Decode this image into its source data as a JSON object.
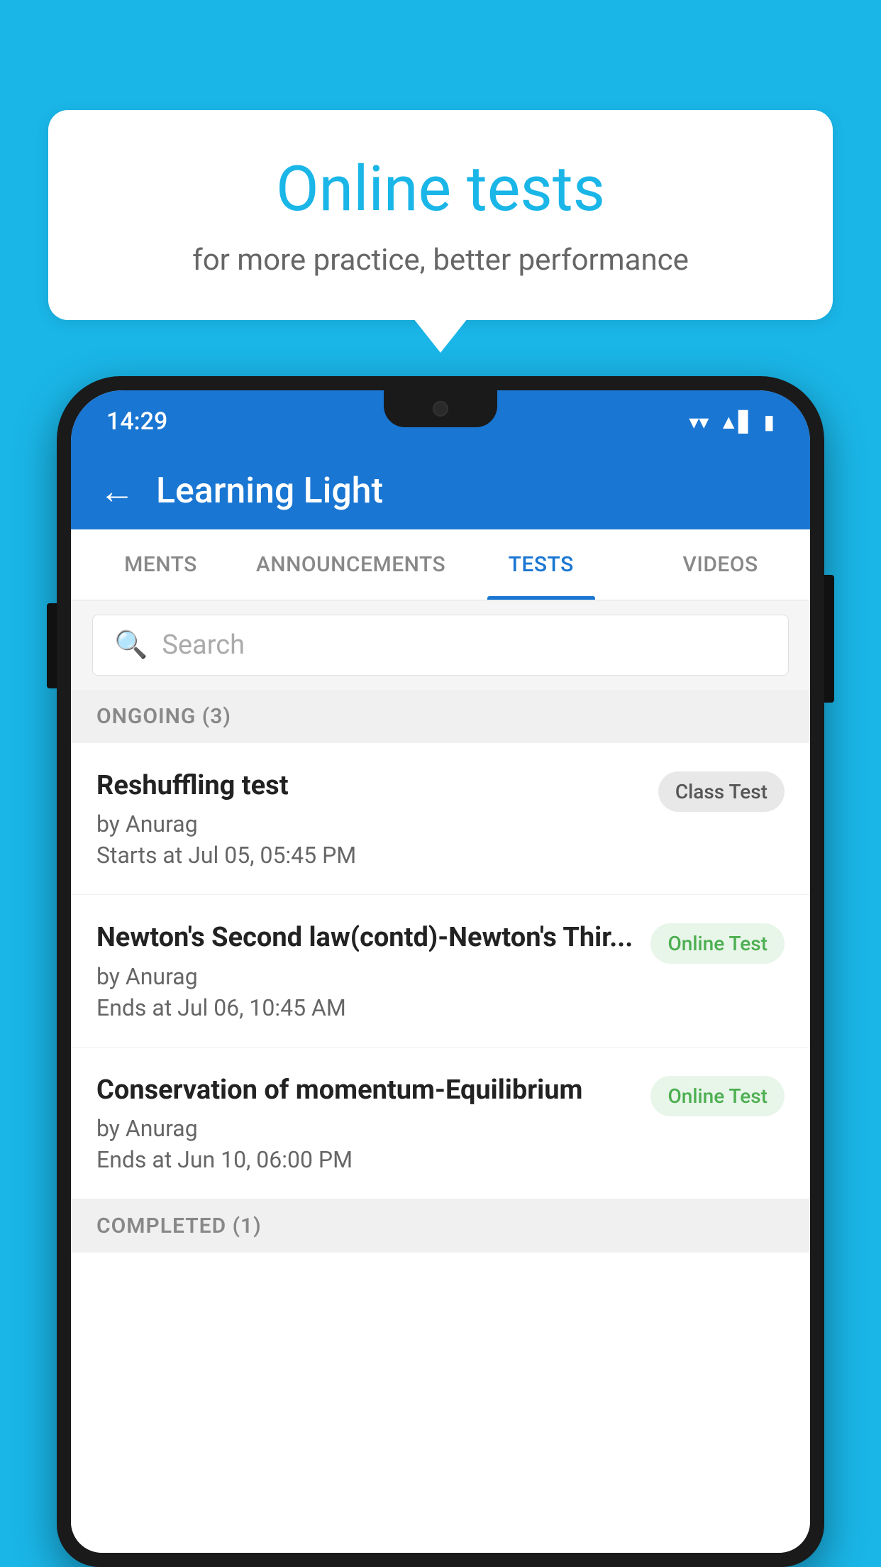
{
  "background": {
    "color": "#1ab6e8"
  },
  "bubble": {
    "title": "Online tests",
    "subtitle": "for more practice, better performance"
  },
  "phone": {
    "status_bar": {
      "time": "14:29",
      "wifi_icon": "▼",
      "signal_icon": "▲",
      "battery_icon": "▮"
    },
    "header": {
      "back_label": "←",
      "title": "Learning Light"
    },
    "tabs": [
      {
        "label": "MENTS",
        "active": false
      },
      {
        "label": "ANNOUNCEMENTS",
        "active": false
      },
      {
        "label": "TESTS",
        "active": true
      },
      {
        "label": "VIDEOS",
        "active": false
      }
    ],
    "search": {
      "placeholder": "Search"
    },
    "ongoing_section": {
      "label": "ONGOING (3)"
    },
    "test_items": [
      {
        "title": "Reshuffling test",
        "by": "by Anurag",
        "time": "Starts at  Jul 05, 05:45 PM",
        "badge": "Class Test",
        "badge_type": "class"
      },
      {
        "title": "Newton's Second law(contd)-Newton's Thir...",
        "by": "by Anurag",
        "time": "Ends at  Jul 06, 10:45 AM",
        "badge": "Online Test",
        "badge_type": "online"
      },
      {
        "title": "Conservation of momentum-Equilibrium",
        "by": "by Anurag",
        "time": "Ends at  Jun 10, 06:00 PM",
        "badge": "Online Test",
        "badge_type": "online"
      }
    ],
    "completed_section": {
      "label": "COMPLETED (1)"
    }
  }
}
